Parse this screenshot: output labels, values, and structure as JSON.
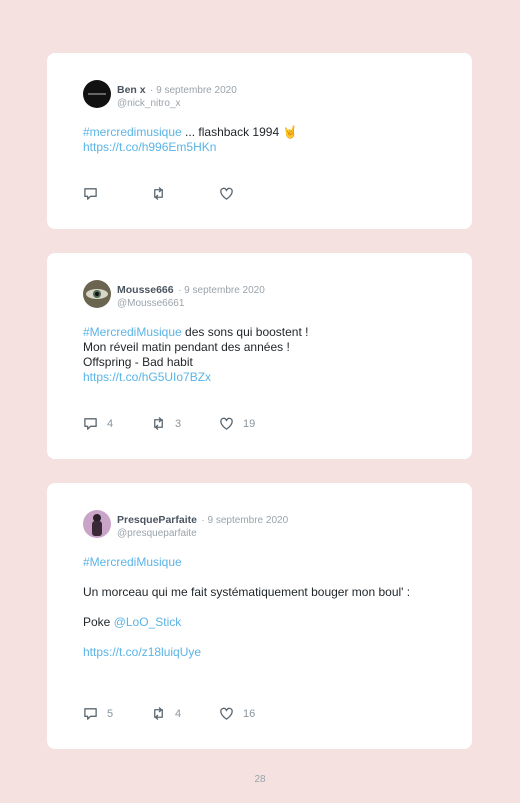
{
  "tweets": [
    {
      "name": "Ben x",
      "date": "· 9 septembre 2020",
      "handle": "@nick_nitro_x",
      "avatar": "ben-avatar",
      "lines": [
        [
          {
            "t": "tag",
            "v": "#mercredimusique"
          },
          {
            "t": "text",
            "v": " ... flashback 1994 🤘"
          }
        ],
        [
          {
            "t": "link",
            "v": "https://t.co/h996Em5HKn"
          }
        ]
      ],
      "replies": "",
      "retweets": "",
      "likes": ""
    },
    {
      "name": "Mousse666",
      "date": "· 9 septembre 2020",
      "handle": "@Mousse6661",
      "avatar": "mousse-avatar",
      "lines": [
        [
          {
            "t": "tag",
            "v": "#MercrediMusique"
          },
          {
            "t": "text",
            "v": " des sons qui boostent !"
          }
        ],
        [
          {
            "t": "text",
            "v": "Mon réveil matin pendant des années !"
          }
        ],
        [
          {
            "t": "text",
            "v": "Offspring - Bad habit"
          }
        ],
        [
          {
            "t": "link",
            "v": "https://t.co/hG5UIo7BZx"
          }
        ]
      ],
      "replies": "4",
      "retweets": "3",
      "likes": "19"
    },
    {
      "name": "PresqueParfaite",
      "date": "· 9 septembre 2020",
      "handle": "@presqueparfaite",
      "avatar": "presque-avatar",
      "lines": [
        [
          {
            "t": "tag",
            "v": "#MercrediMusique"
          }
        ],
        [],
        [
          {
            "t": "text",
            "v": "Un morceau qui me fait systématiquement bouger mon boul' :"
          }
        ],
        [],
        [
          {
            "t": "text",
            "v": "Poke "
          },
          {
            "t": "tag",
            "v": "@LoO_Stick"
          }
        ],
        [],
        [
          {
            "t": "link",
            "v": "https://t.co/z18luiqUye"
          }
        ]
      ],
      "replies": "5",
      "retweets": "4",
      "likes": "16"
    }
  ],
  "page_number": "28",
  "colors": {
    "background": "#f5e2e0",
    "link": "#5ab4e6"
  }
}
